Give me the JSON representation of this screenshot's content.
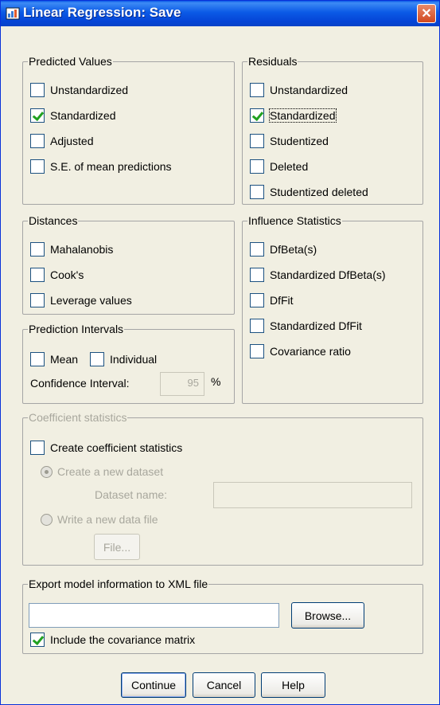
{
  "window": {
    "title": "Linear Regression: Save",
    "close_label": "✕"
  },
  "predicted": {
    "label": "Predicted Values",
    "items": [
      {
        "label": "Unstandardized",
        "checked": false
      },
      {
        "label": "Standardized",
        "checked": true
      },
      {
        "label": "Adjusted",
        "checked": false
      },
      {
        "label": "S.E. of mean predictions",
        "checked": false
      }
    ]
  },
  "residuals": {
    "label": "Residuals",
    "items": [
      {
        "label": "Unstandardized",
        "checked": false
      },
      {
        "label": "Standardized",
        "checked": true
      },
      {
        "label": "Studentized",
        "checked": false
      },
      {
        "label": "Deleted",
        "checked": false
      },
      {
        "label": "Studentized deleted",
        "checked": false
      }
    ]
  },
  "distances": {
    "label": "Distances",
    "items": [
      {
        "label": "Mahalanobis",
        "checked": false
      },
      {
        "label": "Cook's",
        "checked": false
      },
      {
        "label": "Leverage values",
        "checked": false
      }
    ]
  },
  "influence": {
    "label": "Influence Statistics",
    "items": [
      {
        "label": "DfBeta(s)",
        "checked": false
      },
      {
        "label": "Standardized DfBeta(s)",
        "checked": false
      },
      {
        "label": "DfFit",
        "checked": false
      },
      {
        "label": "Standardized DfFit",
        "checked": false
      },
      {
        "label": "Covariance ratio",
        "checked": false
      }
    ]
  },
  "prediction_intervals": {
    "label": "Prediction Intervals",
    "mean_label": "Mean",
    "individual_label": "Individual",
    "confidence_label": "Confidence Interval:",
    "confidence_value": "95",
    "percent": "%"
  },
  "coefficient": {
    "label": "Coefficient statistics",
    "create_label": "Create coefficient statistics",
    "new_dataset_label": "Create a new dataset",
    "dataset_name_label": "Dataset name:",
    "dataset_name_value": "",
    "write_file_label": "Write a new data file",
    "file_button": "File..."
  },
  "export": {
    "label": "Export model information to XML file",
    "path_value": "",
    "browse_button": "Browse...",
    "include_cov_label": "Include the covariance matrix",
    "include_cov_checked": true
  },
  "buttons": {
    "continue": "Continue",
    "cancel": "Cancel",
    "help": "Help"
  },
  "colors": {
    "titlebar": "#0b5ae6",
    "close": "#d2481f",
    "check": "#21a121"
  }
}
